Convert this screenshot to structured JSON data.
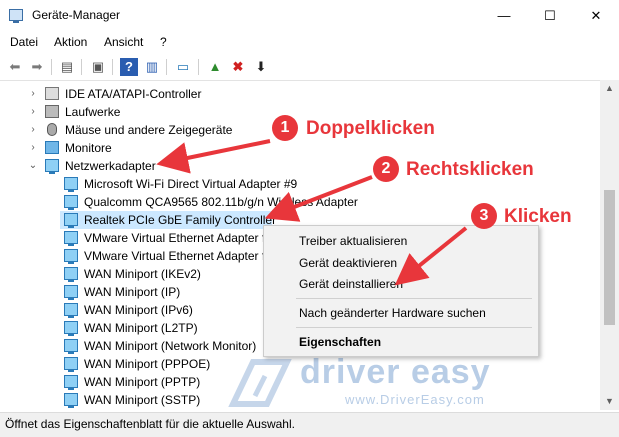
{
  "window": {
    "title": "Geräte-Manager",
    "controls": {
      "minimize": "—",
      "maximize": "☐",
      "close": "✕"
    }
  },
  "menu": [
    "Datei",
    "Aktion",
    "Ansicht",
    "?"
  ],
  "tree": {
    "categories": [
      {
        "label": "IDE ATA/ATAPI-Controller",
        "icon": "ide-controller-icon"
      },
      {
        "label": "Laufwerke",
        "icon": "disk-drive-icon"
      },
      {
        "label": "Mäuse und andere Zeigegeräte",
        "icon": "mouse-icon"
      },
      {
        "label": "Monitore",
        "icon": "monitor-icon"
      },
      {
        "label": "Netzwerkadapter",
        "icon": "network-adapter-icon"
      }
    ],
    "adapters": [
      "Microsoft Wi-Fi Direct Virtual Adapter #9",
      "Qualcomm QCA9565 802.11b/g/n Wireless Adapter",
      "Realtek PCIe GbE Family Controller",
      "VMware Virtual Ethernet Adapter for VMnet1",
      "VMware Virtual Ethernet Adapter for VMnet8",
      "WAN Miniport (IKEv2)",
      "WAN Miniport (IP)",
      "WAN Miniport (IPv6)",
      "WAN Miniport (L2TP)",
      "WAN Miniport (Network Monitor)",
      "WAN Miniport (PPPOE)",
      "WAN Miniport (PPTP)",
      "WAN Miniport (SSTP)"
    ],
    "selected": "Realtek PCIe GbE Family Controller"
  },
  "context_menu": {
    "update": "Treiber aktualisieren",
    "disable": "Gerät deaktivieren",
    "uninstall": "Gerät deinstallieren",
    "scan": "Nach geänderter Hardware suchen",
    "properties": "Eigenschaften"
  },
  "annotations": [
    {
      "number": "1",
      "text": "Doppelklicken"
    },
    {
      "number": "2",
      "text": "Rechtsklicken"
    },
    {
      "number": "3",
      "text": "Klicken"
    }
  ],
  "status": "Öffnet das Eigenschaftenblatt für die aktuelle Auswahl.",
  "watermark": {
    "brand": "driver easy",
    "url": "www.DriverEasy.com"
  },
  "colors": {
    "annotation": "#e8363b",
    "selection": "#cce8ff",
    "watermark": "#b8cde6"
  }
}
